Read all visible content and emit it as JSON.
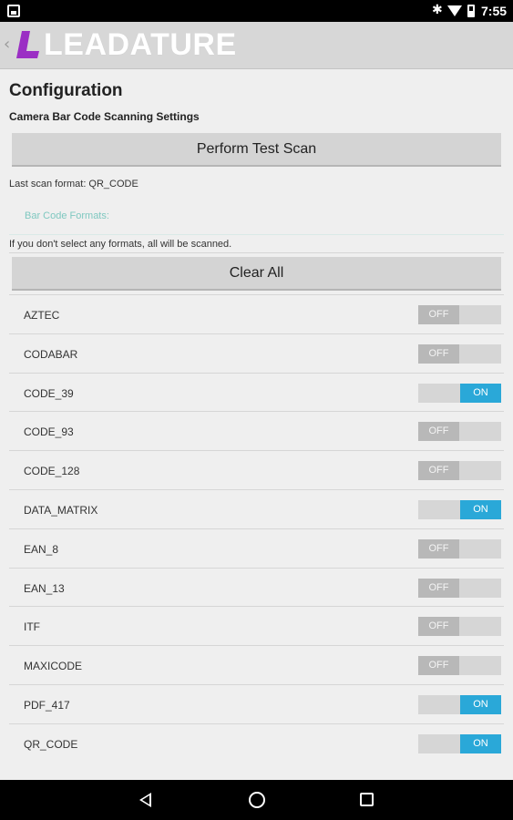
{
  "status_bar": {
    "time": "7:55",
    "bluetooth_icon": "bluetooth-icon",
    "wifi_icon": "wifi-icon",
    "battery_icon": "battery-icon"
  },
  "app_bar": {
    "brand": "LEADATURE",
    "back_icon": "chevron-left-icon",
    "logo_color": "#9b2fc4"
  },
  "page": {
    "title": "Configuration",
    "subtitle": "Camera Bar Code Scanning Settings",
    "test_scan_label": "Perform Test Scan",
    "last_scan": "Last scan format: QR_CODE",
    "formats_header": "Bar Code Formats:",
    "hint": "If you don't select any formats, all will be scanned.",
    "clear_all_label": "Clear All"
  },
  "toggle_labels": {
    "on": "ON",
    "off": "OFF"
  },
  "formats": [
    {
      "name": "AZTEC",
      "enabled": false,
      "state": "OFF"
    },
    {
      "name": "CODABAR",
      "enabled": false,
      "state": "OFF"
    },
    {
      "name": "CODE_39",
      "enabled": true,
      "state": "ON"
    },
    {
      "name": "CODE_93",
      "enabled": false,
      "state": "OFF"
    },
    {
      "name": "CODE_128",
      "enabled": false,
      "state": "OFF"
    },
    {
      "name": "DATA_MATRIX",
      "enabled": true,
      "state": "ON"
    },
    {
      "name": "EAN_8",
      "enabled": false,
      "state": "OFF"
    },
    {
      "name": "EAN_13",
      "enabled": false,
      "state": "OFF"
    },
    {
      "name": "ITF",
      "enabled": false,
      "state": "OFF"
    },
    {
      "name": "MAXICODE",
      "enabled": false,
      "state": "OFF"
    },
    {
      "name": "PDF_417",
      "enabled": true,
      "state": "ON"
    },
    {
      "name": "QR_CODE",
      "enabled": true,
      "state": "ON"
    }
  ],
  "colors": {
    "toggle_on": "#2aa8d8",
    "toggle_off": "#b8b8b8",
    "section_header": "#7fc8c0"
  },
  "nav_bar": {
    "back_icon": "nav-back-icon",
    "home_icon": "nav-home-icon",
    "recents_icon": "nav-recents-icon"
  }
}
